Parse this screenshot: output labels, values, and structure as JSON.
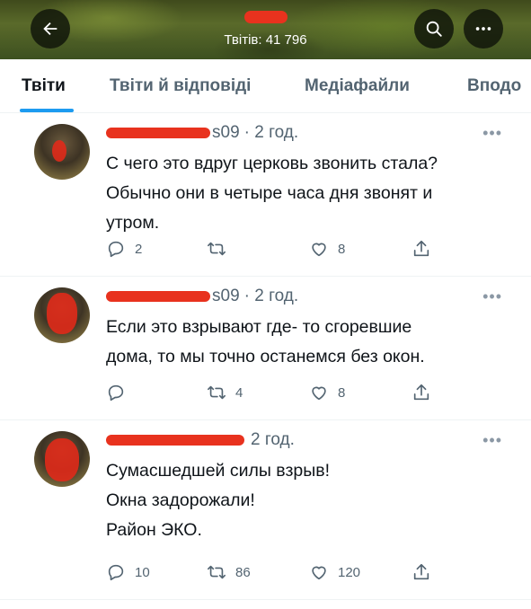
{
  "header": {
    "back_icon": "arrow-left-icon",
    "search_icon": "search-icon",
    "more_icon": "more-horizontal-icon",
    "tweet_count": "Твітів: 41 796"
  },
  "tabs": [
    {
      "label": "Твіти",
      "active": true
    },
    {
      "label": "Твіти й відповіді",
      "active": false
    },
    {
      "label": "Медіафайли",
      "active": false
    },
    {
      "label": "Вподо",
      "active": false
    }
  ],
  "tweets": [
    {
      "handle_tail": "s09",
      "time": "· 2 год.",
      "text": "С чего это вдруг церковь звонить стала?\nОбычно они в четыре часа дня звонят и\nутром.",
      "replies": "2",
      "retweets": "",
      "likes": "8"
    },
    {
      "handle_tail": "s09",
      "time": "· 2 год.",
      "text": "Если это взрывают где- то сгоревшие\nдома, то мы точно останемся без окон.",
      "replies": "",
      "retweets": "4",
      "likes": "8"
    },
    {
      "handle_tail": "",
      "time": "2 год.",
      "text": "Сумасшедшей силы взрыв!\nОкна задорожали!\nРайон ЭКО.",
      "replies": "10",
      "retweets": "86",
      "likes": "120"
    }
  ],
  "colors": {
    "accent": "#1d9bf0",
    "secondary_text": "#536471",
    "redaction": "#e8321e"
  }
}
